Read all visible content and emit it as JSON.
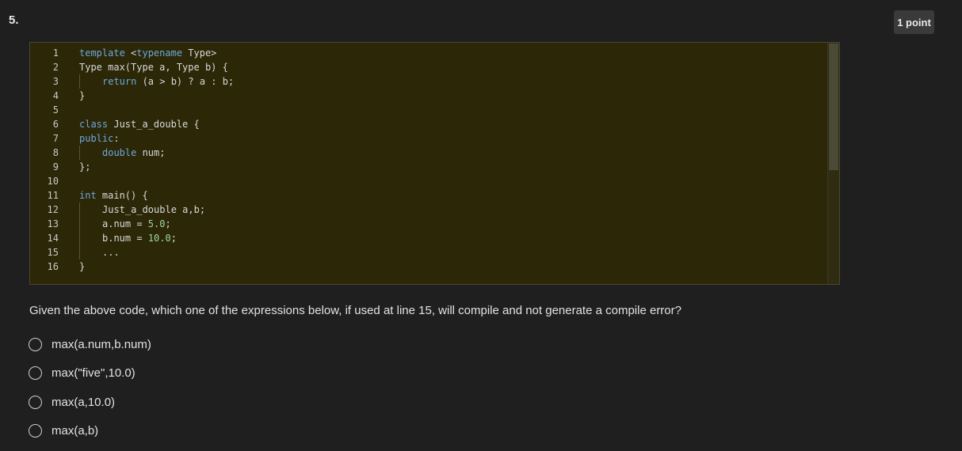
{
  "question": {
    "number": "5.",
    "points": "1 point",
    "text": "Given the above code, which one of the expressions below, if used at line 15,  will compile and not generate a compile error?"
  },
  "code": {
    "lines": [
      {
        "n": "1",
        "indent": 0,
        "tokens": [
          {
            "t": "template",
            "c": "kw"
          },
          {
            "t": " <"
          },
          {
            "t": "typename",
            "c": "kw"
          },
          {
            "t": " Type>"
          }
        ]
      },
      {
        "n": "2",
        "indent": 0,
        "tokens": [
          {
            "t": "Type max(Type a, Type b) {"
          }
        ]
      },
      {
        "n": "3",
        "indent": 1,
        "tokens": [
          {
            "t": "return",
            "c": "kw"
          },
          {
            "t": " (a > b) ? a : b;"
          }
        ]
      },
      {
        "n": "4",
        "indent": 0,
        "tokens": [
          {
            "t": "}"
          }
        ]
      },
      {
        "n": "5",
        "indent": 0,
        "tokens": []
      },
      {
        "n": "6",
        "indent": 0,
        "tokens": [
          {
            "t": "class",
            "c": "kw"
          },
          {
            "t": " Just_a_double {"
          }
        ]
      },
      {
        "n": "7",
        "indent": 0,
        "tokens": [
          {
            "t": "public",
            "c": "kw"
          },
          {
            "t": ":"
          }
        ]
      },
      {
        "n": "8",
        "indent": 1,
        "tokens": [
          {
            "t": "double",
            "c": "kw"
          },
          {
            "t": " num;"
          }
        ]
      },
      {
        "n": "9",
        "indent": 0,
        "tokens": [
          {
            "t": "};"
          }
        ]
      },
      {
        "n": "10",
        "indent": 0,
        "tokens": []
      },
      {
        "n": "11",
        "indent": 0,
        "tokens": [
          {
            "t": "int",
            "c": "kw"
          },
          {
            "t": " main() {"
          }
        ]
      },
      {
        "n": "12",
        "indent": 1,
        "tokens": [
          {
            "t": "Just_a_double a,b;"
          }
        ]
      },
      {
        "n": "13",
        "indent": 1,
        "tokens": [
          {
            "t": "a.num = "
          },
          {
            "t": "5.0",
            "c": "num"
          },
          {
            "t": ";"
          }
        ]
      },
      {
        "n": "14",
        "indent": 1,
        "tokens": [
          {
            "t": "b.num = "
          },
          {
            "t": "10.0",
            "c": "num"
          },
          {
            "t": ";"
          }
        ]
      },
      {
        "n": "15",
        "indent": 1,
        "tokens": [
          {
            "t": "..."
          }
        ]
      },
      {
        "n": "16",
        "indent": 0,
        "tokens": [
          {
            "t": "}"
          }
        ]
      }
    ]
  },
  "options": [
    {
      "label": "max(a.num,b.num)"
    },
    {
      "label": "max(\"five\",10.0)"
    },
    {
      "label": "max(a,10.0)"
    },
    {
      "label": "max(a,b)"
    }
  ]
}
